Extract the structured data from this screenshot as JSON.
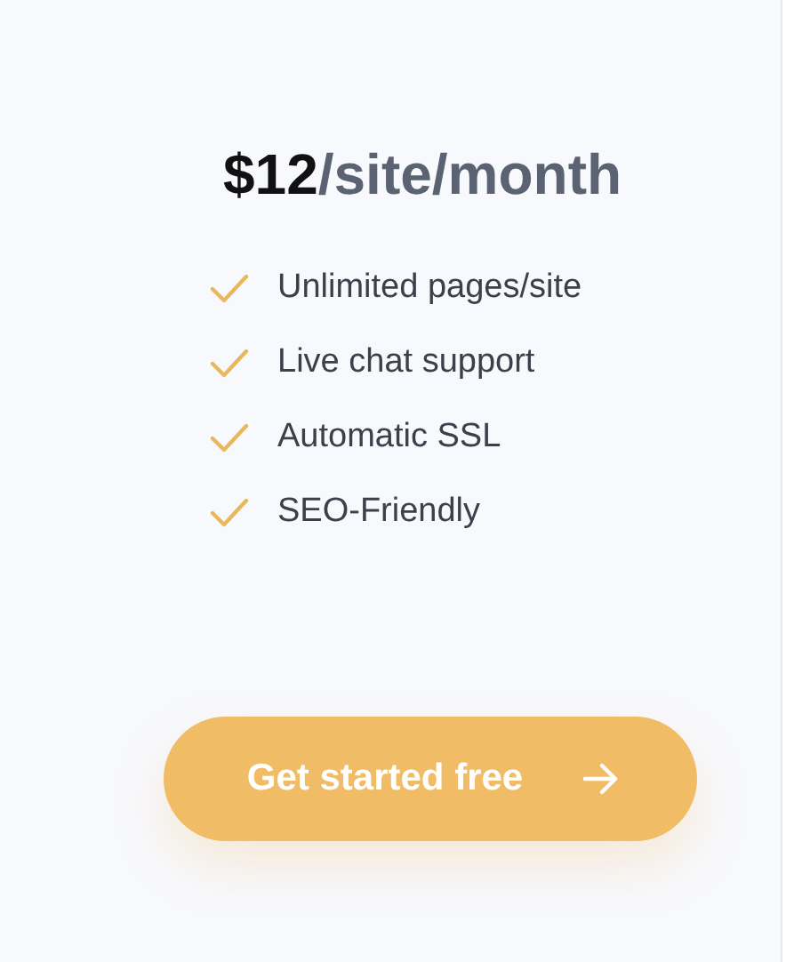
{
  "price": {
    "amount": "$12",
    "unit": "/site/month"
  },
  "features": [
    {
      "label": "Unlimited pages/site"
    },
    {
      "label": "Live chat support"
    },
    {
      "label": "Automatic SSL"
    },
    {
      "label": "SEO-Friendly"
    }
  ],
  "button": {
    "label": "Get started free"
  }
}
